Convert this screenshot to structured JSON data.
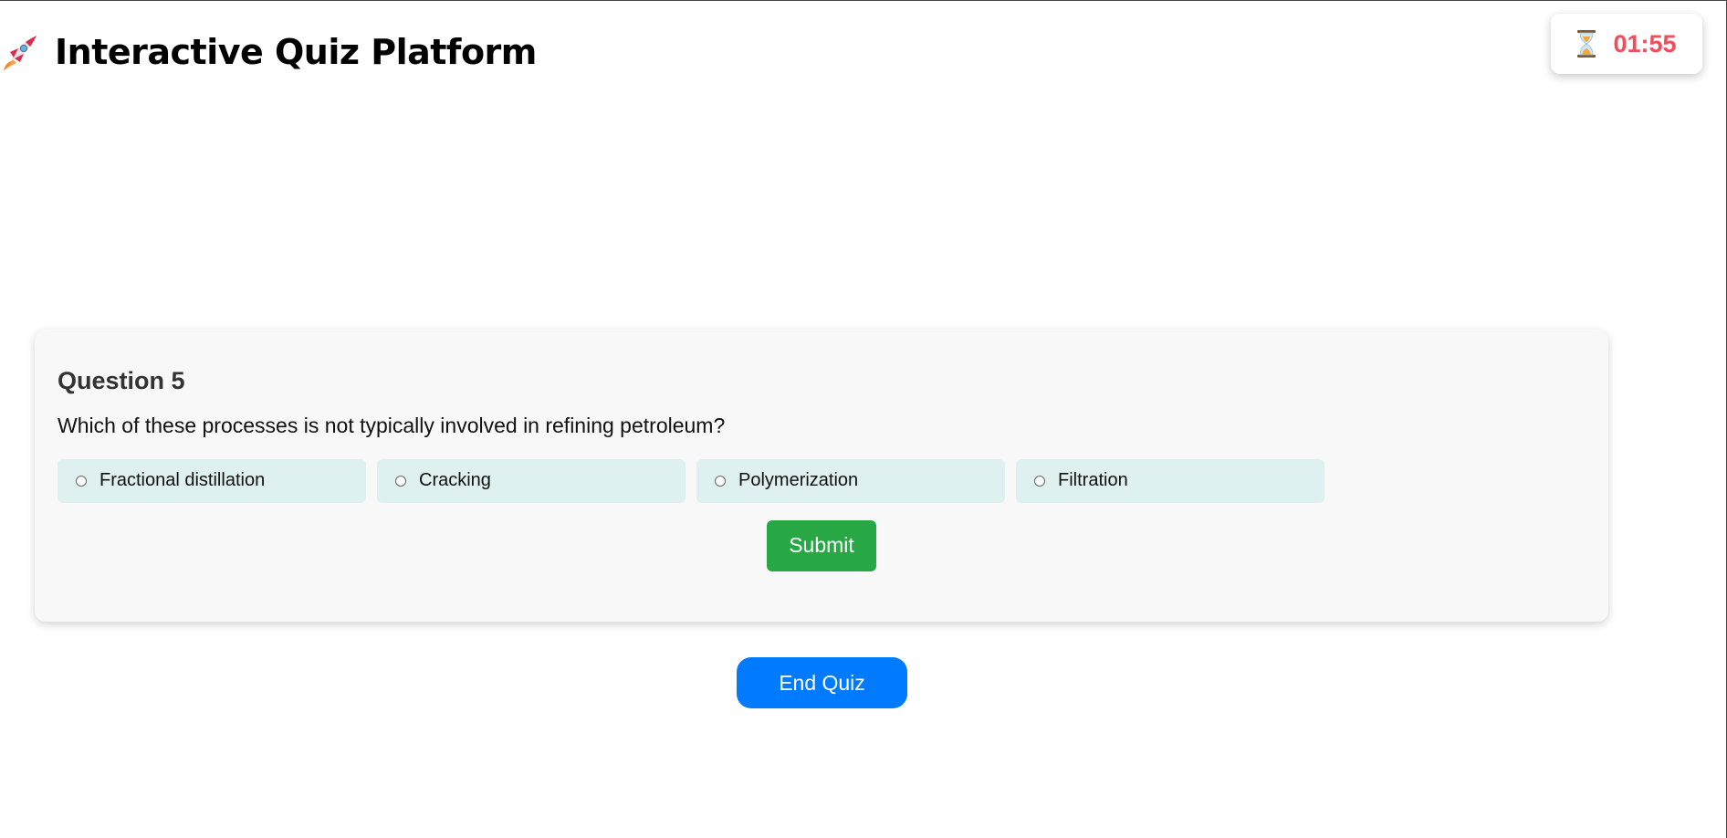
{
  "header": {
    "icon": "rocket-icon",
    "title": "Interactive Quiz Platform"
  },
  "timer": {
    "icon": "hourglass-icon",
    "value": "01:55",
    "color": "#f24d5a"
  },
  "question": {
    "title": "Question 5",
    "text": "Which of these processes is not typically involved in refining petroleum?",
    "options": [
      {
        "label": "Fractional distillation"
      },
      {
        "label": "Cracking"
      },
      {
        "label": "Polymerization"
      },
      {
        "label": "Filtration"
      }
    ],
    "submit_label": "Submit"
  },
  "end_quiz_label": "End Quiz",
  "colors": {
    "submit": "#28a745",
    "end_quiz": "#007bff",
    "option_bg": "#dff0f0",
    "card_bg": "#f8f8f8"
  }
}
